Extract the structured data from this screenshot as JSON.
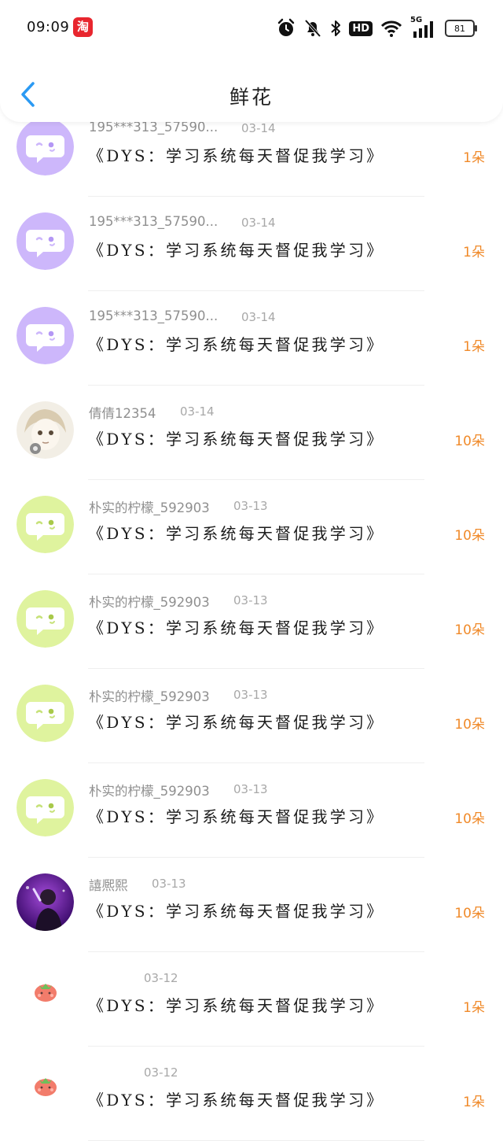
{
  "status_bar": {
    "time": "09:09",
    "app_badge_text": "淘",
    "hd_label": "HD",
    "network_label": "5G",
    "battery_level": "81"
  },
  "header": {
    "title": "鲜花",
    "back_icon": "chevron-left-icon"
  },
  "colors": {
    "accent_blue": "#2b9af3",
    "count_orange": "#f08a2a",
    "avatar_purple": "#cdb7fb",
    "avatar_green": "#dff39e"
  },
  "rows": [
    {
      "name": "195***313_57590...",
      "date": "03-14",
      "message": "《DYS：学习系统每天督促我学习》",
      "count": "1朵",
      "avatar": "purple"
    },
    {
      "name": "195***313_57590...",
      "date": "03-14",
      "message": "《DYS：学习系统每天督促我学习》",
      "count": "1朵",
      "avatar": "purple"
    },
    {
      "name": "195***313_57590...",
      "date": "03-14",
      "message": "《DYS：学习系统每天督促我学习》",
      "count": "1朵",
      "avatar": "purple"
    },
    {
      "name": "倩倩12354",
      "date": "03-14",
      "message": "《DYS：学习系统每天督促我学习》",
      "count": "10朵",
      "avatar": "anime"
    },
    {
      "name": "朴实的柠檬_592903",
      "date": "03-13",
      "message": "《DYS：学习系统每天督促我学习》",
      "count": "10朵",
      "avatar": "green"
    },
    {
      "name": "朴实的柠檬_592903",
      "date": "03-13",
      "message": "《DYS：学习系统每天督促我学习》",
      "count": "10朵",
      "avatar": "green"
    },
    {
      "name": "朴实的柠檬_592903",
      "date": "03-13",
      "message": "《DYS：学习系统每天督促我学习》",
      "count": "10朵",
      "avatar": "green"
    },
    {
      "name": "朴实的柠檬_592903",
      "date": "03-13",
      "message": "《DYS：学习系统每天督促我学习》",
      "count": "10朵",
      "avatar": "green"
    },
    {
      "name": "譆熈熙",
      "date": "03-13",
      "message": "《DYS：学习系统每天督促我学习》",
      "count": "10朵",
      "avatar": "photo"
    },
    {
      "name": "",
      "date": "03-12",
      "message": "《DYS：学习系统每天督促我学习》",
      "count": "1朵",
      "avatar": "strawberry"
    },
    {
      "name": "",
      "date": "03-12",
      "message": "《DYS：学习系统每天督促我学习》",
      "count": "1朵",
      "avatar": "strawberry"
    }
  ]
}
